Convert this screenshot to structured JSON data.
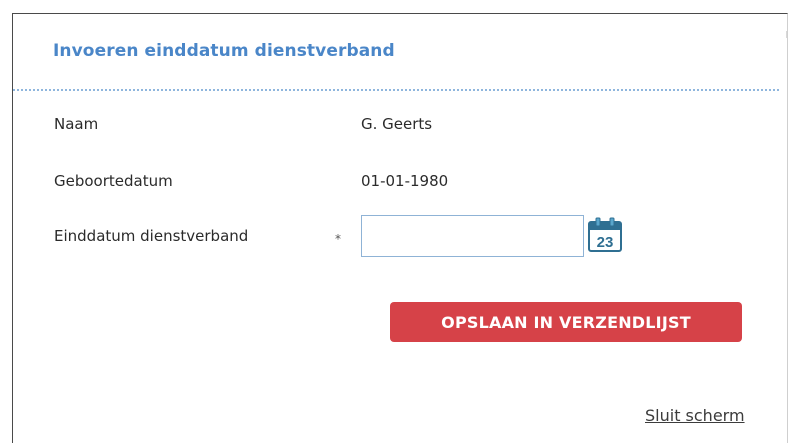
{
  "dialog": {
    "title": "Invoeren einddatum dienstverband"
  },
  "fields": {
    "name_label": "Naam",
    "name_value": "G. Geerts",
    "birthdate_label": "Geboortedatum",
    "birthdate_value": "01-01-1980",
    "end_date_label": "Einddatum dienstverband",
    "end_date_required_marker": "*",
    "end_date_value": "",
    "calendar_day": "23"
  },
  "actions": {
    "save_label": "OPSLAAN IN VERZENDLIJST",
    "close_label": "Sluit scherm"
  },
  "colors": {
    "title": "#4a86c8",
    "save_button": "#d64248",
    "input_border": "#8fb3d6"
  },
  "icons": {
    "calendar": "calendar-icon"
  }
}
